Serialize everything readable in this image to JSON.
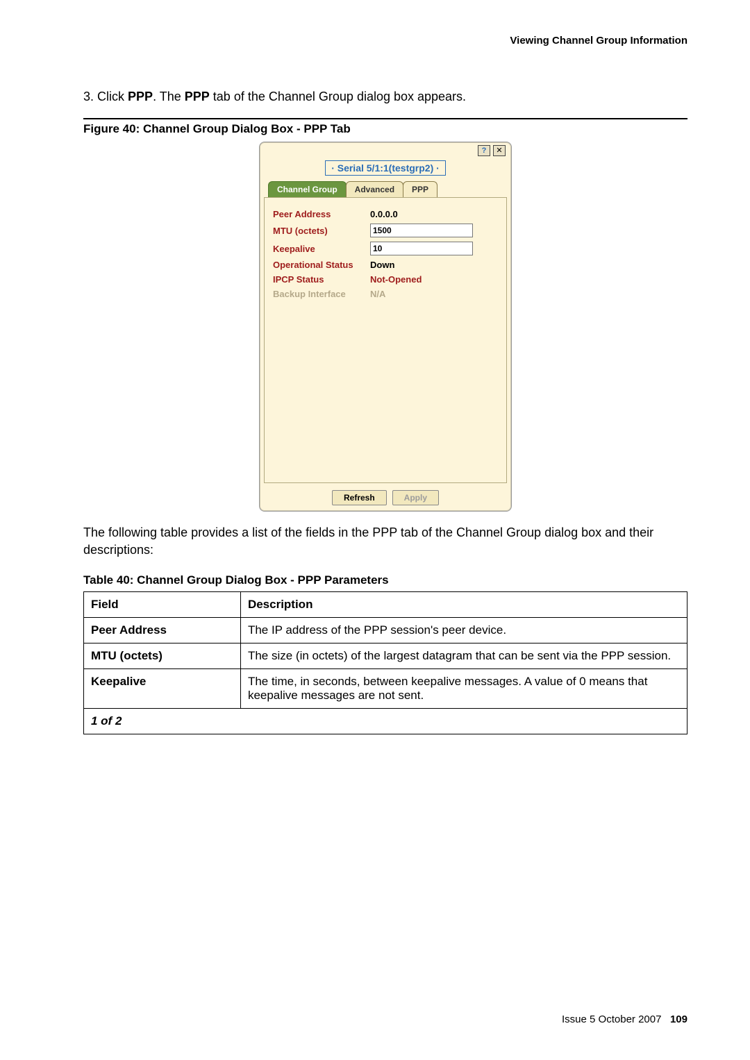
{
  "header": {
    "section_title": "Viewing Channel Group Information"
  },
  "step": {
    "num": "3.",
    "prefix": "Click ",
    "term1": "PPP",
    "mid": ". The ",
    "term2": "PPP",
    "suffix": " tab of the Channel Group dialog box appears."
  },
  "figure": {
    "caption": "Figure 40: Channel Group Dialog Box - PPP Tab"
  },
  "dialog": {
    "title": "· Serial 5/1:1(testgrp2) ·",
    "help_icon": "?",
    "close_icon": "✕",
    "tabs": [
      {
        "label": "Channel Group",
        "selected": true
      },
      {
        "label": "Advanced",
        "selected": false
      },
      {
        "label": "PPP",
        "selected": false
      }
    ],
    "fields": {
      "peer_address": {
        "label": "Peer Address",
        "value": "0.0.0.0"
      },
      "mtu": {
        "label": "MTU (octets)",
        "value": "1500"
      },
      "keepalive": {
        "label": "Keepalive",
        "value": "10"
      },
      "op_status": {
        "label": "Operational Status",
        "value": "Down"
      },
      "ipcp": {
        "label": "IPCP Status",
        "value": "Not-Opened"
      },
      "backup": {
        "label": "Backup Interface",
        "value": "N/A"
      }
    },
    "buttons": {
      "refresh": "Refresh",
      "apply": "Apply"
    }
  },
  "para2": "The following table provides a list of the fields in the PPP tab of the Channel Group dialog box and their descriptions:",
  "table": {
    "caption": "Table 40: Channel Group Dialog Box - PPP Parameters",
    "head": {
      "field": "Field",
      "desc": "Description"
    },
    "rows": [
      {
        "field": "Peer Address",
        "desc": "The IP address of the PPP session's peer device."
      },
      {
        "field": "MTU (octets)",
        "desc": "The size (in octets) of the largest datagram that can be sent via the PPP session."
      },
      {
        "field": "Keepalive",
        "desc": "The time, in seconds, between keepalive messages. A value of 0 means that keepalive messages are not sent."
      }
    ],
    "page_count": "1 of 2"
  },
  "footer": {
    "issue": "Issue 5   October 2007",
    "page": "109"
  }
}
